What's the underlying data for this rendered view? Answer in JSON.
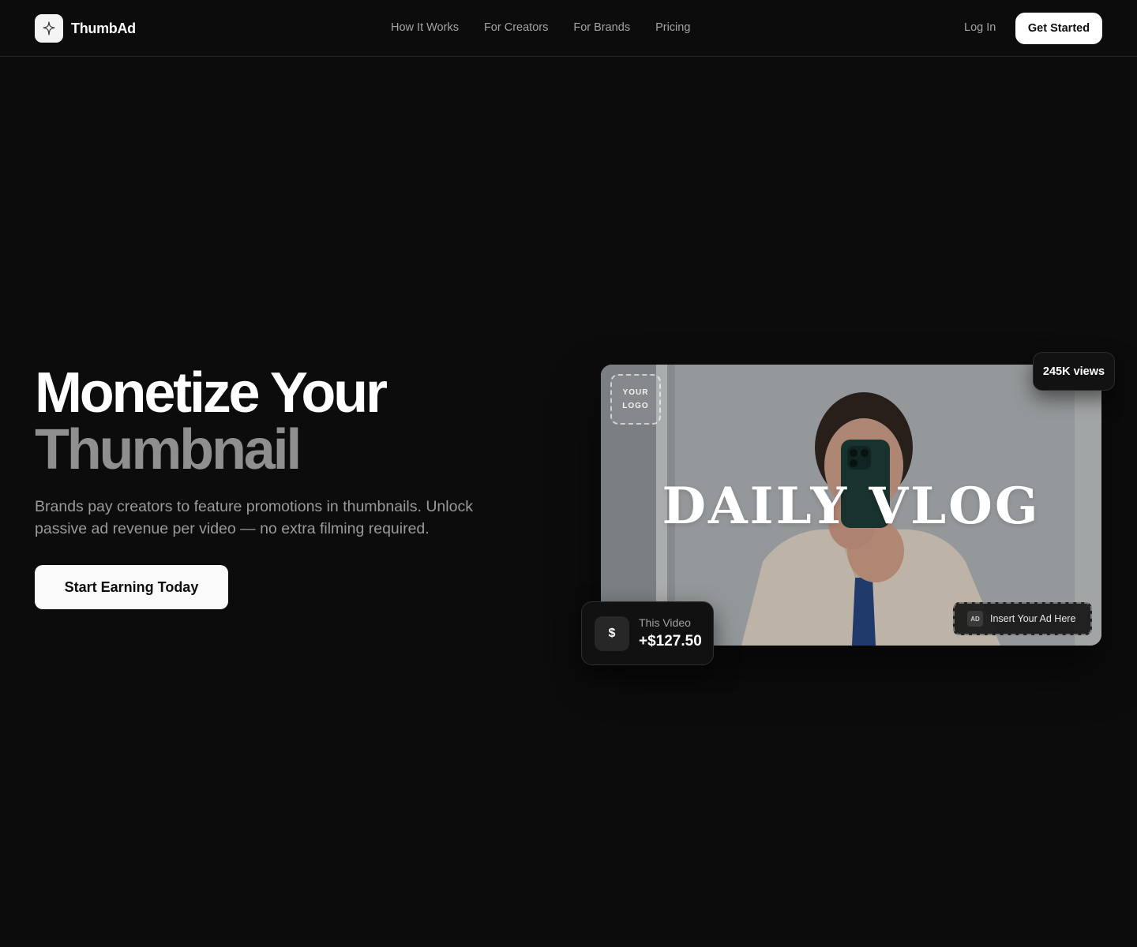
{
  "brand": {
    "name": "ThumbAd",
    "logo_icon": "plus-sparkle-icon"
  },
  "nav": {
    "links": [
      "How It Works",
      "For Creators",
      "For Brands",
      "Pricing"
    ],
    "login_label": "Log In",
    "cta_label": "Get Started"
  },
  "hero": {
    "title_line1": "Monetize Your",
    "title_line2": "Thumbnail",
    "subtitle": "Brands pay creators to feature promotions in thumbnails. Unlock passive ad revenue per video — no extra filming required.",
    "cta_label": "Start Earning Today"
  },
  "preview": {
    "title": "DAILY VLOG",
    "logo_slot_line1": "YOUR",
    "logo_slot_line2": "LOGO",
    "ad_badge": "AD",
    "ad_slot_label": "Insert Your Ad Here",
    "views": "245K views",
    "earnings_icon": "$",
    "earnings_label": "This Video",
    "earnings_value": "+$127.50"
  },
  "colors": {
    "background": "#0c0c0c",
    "text_primary": "#ffffff",
    "text_muted": "#9a9a9a",
    "button_bg": "#fafafa",
    "card_bg": "#111111"
  }
}
